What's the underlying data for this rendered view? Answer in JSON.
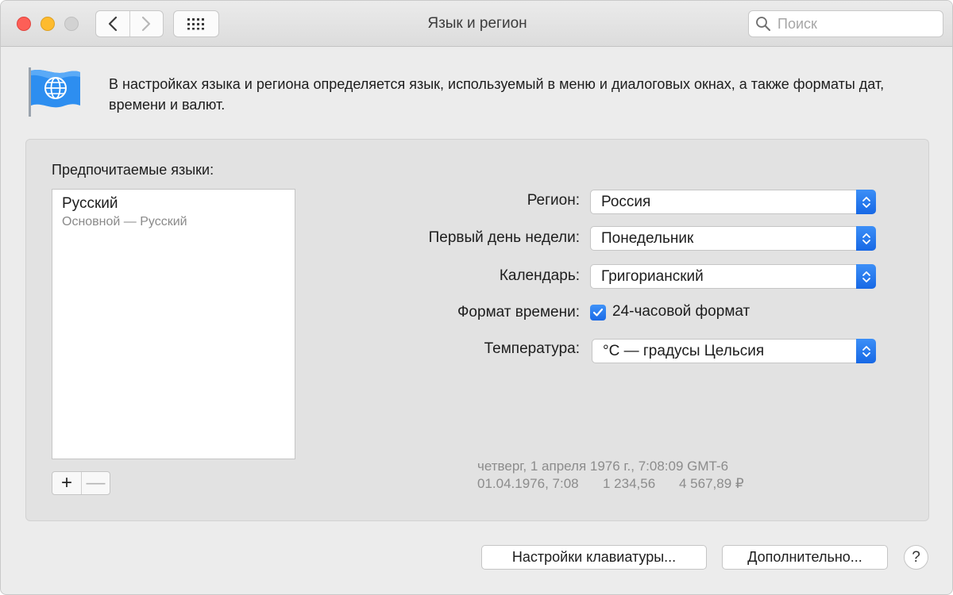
{
  "window": {
    "title": "Язык и регион"
  },
  "toolbar": {
    "search_placeholder": "Поиск",
    "back_icon": "chevron-left-icon",
    "forward_icon": "chevron-right-icon",
    "grid_icon": "grid-icon"
  },
  "intro": {
    "text": "В настройках языка и региона определяется язык, используемый в меню и диалоговых окнах, а также форматы дат, времени и валют."
  },
  "languages": {
    "title": "Предпочитаемые языки:",
    "items": [
      {
        "name": "Русский",
        "subtitle": "Основной — Русский"
      }
    ],
    "add_label": "+",
    "remove_label": "—"
  },
  "settings": {
    "region": {
      "label": "Регион:",
      "value": "Россия"
    },
    "first_day": {
      "label": "Первый день недели:",
      "value": "Понедельник"
    },
    "calendar": {
      "label": "Календарь:",
      "value": "Григорианский"
    },
    "time_format": {
      "label": "Формат времени:",
      "checkbox_label": "24-часовой формат",
      "checked": true
    },
    "temperature": {
      "label": "Температура:",
      "value": "°C — градусы Цельсия"
    }
  },
  "sample": {
    "line1": "четверг, 1 апреля 1976 г., 7:08:09 GMT-6",
    "date_time": "01.04.1976, 7:08",
    "number": "1 234,56",
    "currency": "4 567,89 ₽"
  },
  "buttons": {
    "keyboard": "Настройки клавиатуры...",
    "advanced": "Дополнительно...",
    "help": "?"
  },
  "colors": {
    "accent": "#1b6ae6",
    "close": "#fd5f57",
    "minimize": "#febb2e",
    "zoom_disabled": "#d2d2d2"
  }
}
